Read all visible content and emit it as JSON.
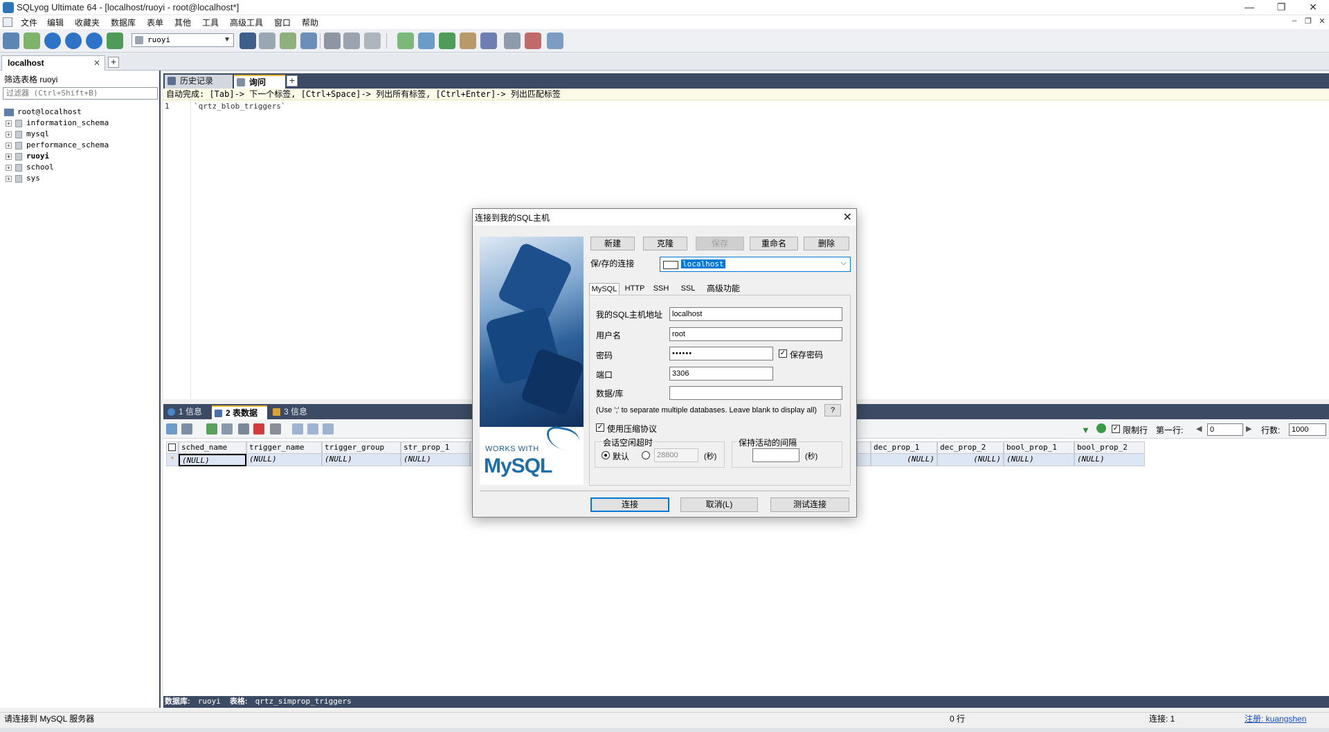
{
  "window": {
    "title": "SQLyog Ultimate 64 - [localhost/ruoyi - root@localhost*]",
    "controls": [
      "—",
      "❐",
      "✕"
    ]
  },
  "menu": [
    "文件",
    "编辑",
    "收藏夹",
    "数据库",
    "表单",
    "其他",
    "工具",
    "高级工具",
    "窗口",
    "帮助"
  ],
  "toolbar": {
    "database_selected": "ruoyi"
  },
  "connection_tab": {
    "label": "localhost",
    "close": "✕",
    "add": "+"
  },
  "left_panel": {
    "filter_label": "筛选表格 ruoyi",
    "filter_placeholder": "过滤器 (Ctrl+Shift+B)",
    "tree": {
      "root": "root@localhost",
      "databases": [
        "information_schema",
        "mysql",
        "performance_schema",
        "ruoyi",
        "school",
        "sys"
      ],
      "active": "ruoyi"
    }
  },
  "query": {
    "tabs": [
      "历史记录",
      "询问"
    ],
    "autocomplete_hint": "自动完成: [Tab]-> 下一个标签, [Ctrl+Space]-> 列出所有标签, [Ctrl+Enter]-> 列出匹配标签",
    "line_number": "1",
    "code": "`qrtz_blob_triggers`"
  },
  "results": {
    "tabs": [
      "1 信息",
      "2 表数据",
      "3 信息"
    ],
    "limit_label": "限制行",
    "first_row_label": "第一行:",
    "first_row_value": "0",
    "rows_label": "行数:",
    "rows_value": "1000",
    "columns": [
      "sched_name",
      "trigger_name",
      "trigger_group",
      "str_prop_1",
      "",
      "dec_prop_1",
      "dec_prop_2",
      "bool_prop_1",
      "bool_prop_2"
    ],
    "row": [
      "(NULL)",
      "(NULL)",
      "(NULL)",
      "(NULL)",
      "(NULL)",
      "(NULL)",
      "(NULL)",
      "(NULL)",
      "(NULL)"
    ]
  },
  "bottom_status": {
    "db_label": "数据库:",
    "db": "ruoyi",
    "table_label": "表格:",
    "table": "qrtz_simprop_triggers"
  },
  "statusbar": {
    "message": "请连接到 MySQL 服务器",
    "rows": "0 行",
    "connections": "连接: 1",
    "register": "注册: kuangshen"
  },
  "dialog": {
    "title": "连接到我的SQL主机",
    "close": "✕",
    "buttons": {
      "new": "新建",
      "clone": "克隆",
      "save": "保存",
      "rename": "重命名",
      "delete": "删除"
    },
    "saved_label": "保/存的连接",
    "saved_value": "localhost",
    "tabs": [
      "MySQL",
      "HTTP",
      "SSH",
      "SSL",
      "高级功能"
    ],
    "fields": {
      "host_label": "我的SQL主机地址",
      "host": "localhost",
      "user_label": "用户名",
      "user": "root",
      "password_label": "密码",
      "password": "••••••",
      "save_password_label": "保存密码",
      "port_label": "端口",
      "port": "3306",
      "database_label": "数据/库",
      "database": "",
      "db_hint": "(Use ';' to separate multiple databases. Leave blank to display all)",
      "help": "?",
      "compress_label": "使用压缩协议",
      "session_timeout_label": "会话空闲超时",
      "default_label": "默认",
      "timeout_value": "28800",
      "seconds": "(秒)",
      "keepalive_label": "保持活动的间隔",
      "keepalive_value": ""
    },
    "logo": {
      "works_with": "WORKS WITH",
      "brand": "MySQL"
    },
    "footer": {
      "connect": "连接",
      "cancel": "取消(L)",
      "test": "测试连接"
    }
  },
  "colors": {
    "panel_dark": "#3c4b63",
    "accent": "#f0b93a",
    "focus_blue": "#0078d7",
    "grid_row": "#dde6f4"
  }
}
